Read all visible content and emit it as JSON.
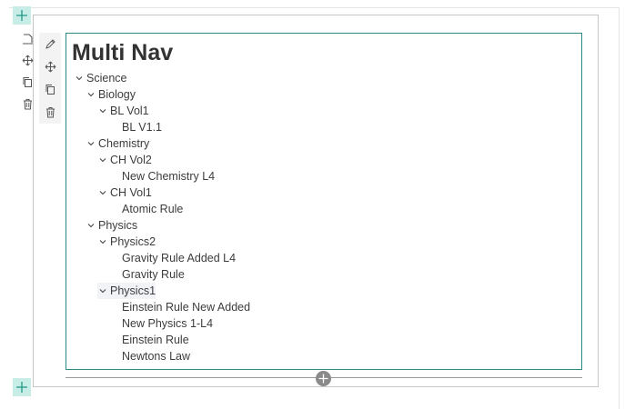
{
  "nav": {
    "title": "Multi Nav",
    "items": [
      {
        "label": "Science",
        "level": 0,
        "expandable": true
      },
      {
        "label": "Biology",
        "level": 1,
        "expandable": true
      },
      {
        "label": "BL Vol1",
        "level": 2,
        "expandable": true
      },
      {
        "label": "BL V1.1",
        "level": 3,
        "expandable": false
      },
      {
        "label": "Chemistry",
        "level": 1,
        "expandable": true
      },
      {
        "label": "CH Vol2",
        "level": 2,
        "expandable": true
      },
      {
        "label": "New Chemistry L4",
        "level": 3,
        "expandable": false
      },
      {
        "label": "CH Vol1",
        "level": 2,
        "expandable": true
      },
      {
        "label": "Atomic Rule",
        "level": 3,
        "expandable": false
      },
      {
        "label": "Physics",
        "level": 1,
        "expandable": true
      },
      {
        "label": "Physics2",
        "level": 2,
        "expandable": true
      },
      {
        "label": "Gravity Rule Added L4",
        "level": 3,
        "expandable": false
      },
      {
        "label": "Gravity Rule",
        "level": 3,
        "expandable": false
      },
      {
        "label": "Physics1",
        "level": 2,
        "expandable": true,
        "selected": true
      },
      {
        "label": "Einstein Rule New Added",
        "level": 3,
        "expandable": false
      },
      {
        "label": "New Physics 1-L4",
        "level": 3,
        "expandable": false
      },
      {
        "label": "Einstein Rule",
        "level": 3,
        "expandable": false
      },
      {
        "label": "Newtons Law",
        "level": 3,
        "expandable": false
      }
    ]
  },
  "toolbar_icons": [
    "edit-icon",
    "move-icon",
    "copy-icon",
    "delete-icon"
  ],
  "colors": {
    "accent": "#2a8a86",
    "add_button_bg": "#c8ece6",
    "selected_row_bg": "#f2f3f7"
  }
}
